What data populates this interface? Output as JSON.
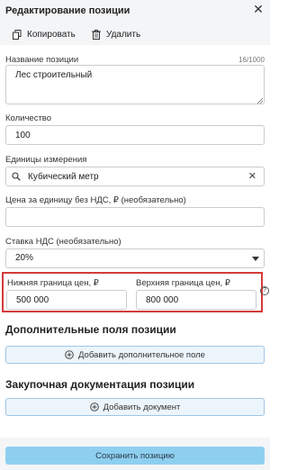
{
  "panel": {
    "title": "Редактирование позиции",
    "close_glyph": "✕",
    "copy_label": "Копировать",
    "delete_label": "Удалить"
  },
  "name_field": {
    "label": "Название позиции",
    "counter": "16/1000",
    "value": "Лес строительный"
  },
  "quantity_field": {
    "label": "Количество",
    "value": "100"
  },
  "units_field": {
    "label": "Единицы измерения",
    "value": "Кубический метр",
    "clear_glyph": "✕"
  },
  "unit_price_field": {
    "label": "Цена за единицу без НДС, ₽ (необязательно)",
    "value": ""
  },
  "vat_field": {
    "label": "Ставка НДС (необязательно)",
    "value": "20%"
  },
  "price_range": {
    "lower_label": "Нижняя граница цен, ₽",
    "lower_value": "500 000",
    "upper_label": "Верхняя граница цен, ₽",
    "upper_value": "800 000",
    "help_glyph": "?"
  },
  "extra_fields": {
    "title": "Дополнительные поля позиции",
    "add_label": "Добавить дополнительное поле"
  },
  "procurement_docs": {
    "title": "Закупочная документация позиции",
    "add_label": "Добавить документ"
  },
  "footer": {
    "save_label": "Сохранить позицию"
  },
  "colors": {
    "highlight_border": "#d43a3a",
    "primary_button": "#8ecff0",
    "ghost_button_bg": "#edf5fc",
    "ghost_button_border": "#9ec5e6"
  },
  "icons": [
    "copy-icon",
    "trash-icon",
    "search-icon",
    "clear-icon",
    "chevron-down-icon",
    "help-icon",
    "plus-circle-icon",
    "close-icon"
  ]
}
